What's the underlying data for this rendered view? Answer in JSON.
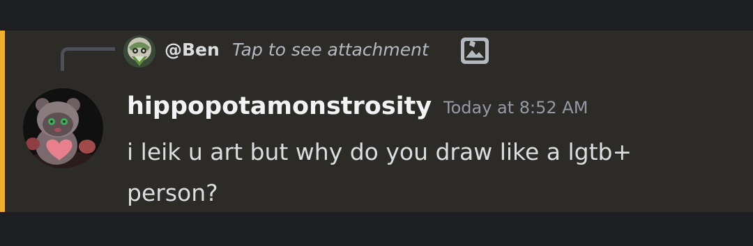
{
  "reply": {
    "author": "@Ben",
    "preview": "Tap to see attachment",
    "attachment_icon": "image-icon",
    "avatar_icon": "ben-avatar"
  },
  "message": {
    "author": "hippopotamonstrosity",
    "timestamp": "Today at 8:52 AM",
    "content": "i leik u art but why do you draw like a lgtb+ person?",
    "avatar_icon": "plush-bear-avatar"
  },
  "colors": {
    "background": "#1d1e22",
    "message_background": "#2d2b27",
    "mention_bar": "#f0b132",
    "author": "#f2f3f5",
    "text": "#dbdee1",
    "muted": "#949ba4"
  }
}
